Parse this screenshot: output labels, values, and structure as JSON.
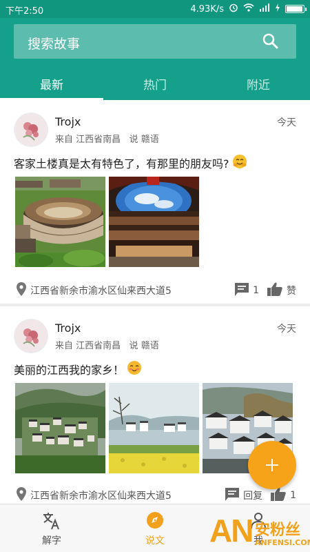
{
  "status_bar": {
    "time": "下午2:50",
    "network_speed": "4.93K/s",
    "icons": [
      "alarm-icon",
      "wifi-icon",
      "signal-icon",
      "charging-icon",
      "battery-icon"
    ],
    "battery_level": 0.9
  },
  "search": {
    "placeholder": "搜索故事",
    "icon": "search-icon"
  },
  "tabs": [
    {
      "label": "最新",
      "active": true
    },
    {
      "label": "热门",
      "active": false
    },
    {
      "label": "附近",
      "active": false
    }
  ],
  "posts": [
    {
      "username": "Trojx",
      "from_prefix": "来自",
      "origin": "江西省南昌",
      "speak_prefix": "说",
      "dialect": "赣语",
      "date": "今天",
      "text": "客家土楼真是太有特色了，有那里的朋友吗?",
      "emoji": "hugging-emoji",
      "photos": [
        "tulou-aerial-photo",
        "tulou-courtyard-photo"
      ],
      "location": "江西省新余市渝水区仙来西大道5",
      "comment_count": "1",
      "like_label": "赞"
    },
    {
      "username": "Trojx",
      "from_prefix": "来自",
      "origin": "江西省南昌",
      "speak_prefix": "说",
      "dialect": "赣语",
      "date": "今天",
      "text": "美丽的江西我的家乡！",
      "emoji": "blush-emoji",
      "photos": [
        "village-mountain-photo",
        "village-lake-photo",
        "village-roofs-photo"
      ],
      "location": "江西省新余市渝水区仙来西大道5",
      "comment_label": "回复",
      "like_count": "1"
    }
  ],
  "fab": {
    "icon": "plus-icon"
  },
  "bottom_nav": [
    {
      "label": "解字",
      "icon": "translate-icon",
      "active": false
    },
    {
      "label": "说文",
      "icon": "compass-icon",
      "active": true
    },
    {
      "label": "我",
      "icon": "person-icon",
      "active": false
    }
  ],
  "watermark": {
    "big": "AN",
    "cn": "安粉丝",
    "en": "ANFENSI.COM"
  },
  "colors": {
    "primary": "#14a08a",
    "status_bar": "#10967f",
    "accent": "#f7a31a"
  }
}
